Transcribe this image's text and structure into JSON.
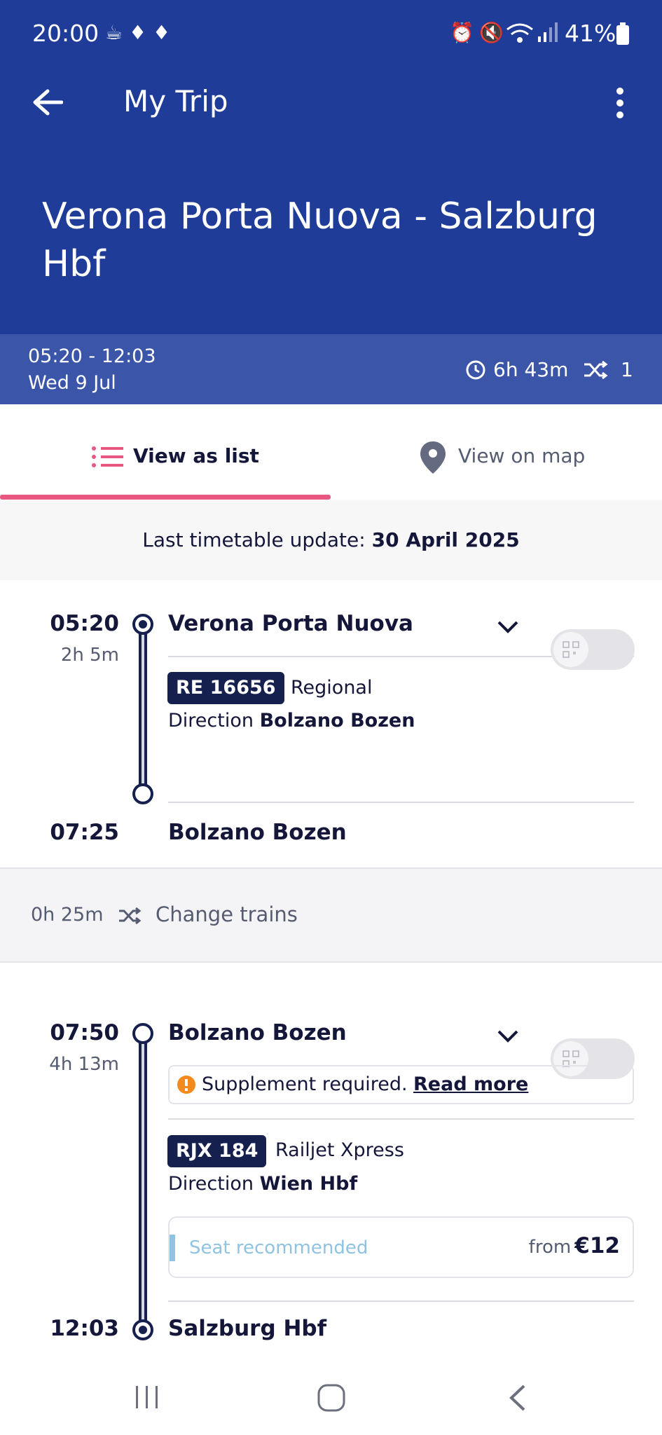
{
  "status_bar": {
    "time": "20:00",
    "battery": "41%"
  },
  "app_bar": {
    "title": "My Trip"
  },
  "route": {
    "title": "Verona Porta Nuova - Salzburg Hbf"
  },
  "summary": {
    "times": "05:20 - 12:03",
    "date": "Wed 9 Jul",
    "duration": "6h 43m",
    "changes": "1"
  },
  "tabs": [
    {
      "label": "View as list"
    },
    {
      "label": "View on map"
    }
  ],
  "timetable_notice": {
    "prefix": "Last timetable update:",
    "date": "30 April 2025"
  },
  "legs": [
    {
      "dep_time": "05:20",
      "duration": "2h  5m",
      "origin": "Verona Porta Nuova",
      "train_number": "RE 16656",
      "train_type": "Regional",
      "direction_prefix": "Direction",
      "direction": "Bolzano Bozen",
      "arr_time": "07:25",
      "destination": "Bolzano Bozen"
    },
    {
      "dep_time": "07:50",
      "duration": "4h 13m",
      "origin": "Bolzano Bozen",
      "supplement_text": "Supplement required.",
      "supplement_link": "Read more",
      "train_number": "RJX 184",
      "train_type": "Railjet Xpress",
      "direction_prefix": "Direction",
      "direction": "Wien Hbf",
      "seat_label": "Seat recommended",
      "price_prefix": "from",
      "price": "€12",
      "arr_time": "12:03",
      "destination": "Salzburg Hbf"
    }
  ],
  "change": {
    "duration": "0h 25m",
    "label": "Change trains"
  },
  "colors": {
    "primary": "#1f3c99",
    "summary_bg": "#3b56a8",
    "accent_pink": "#e8577f",
    "badge": "#16204f",
    "warning": "#f28a1e",
    "seat": "#8fc3e2"
  }
}
